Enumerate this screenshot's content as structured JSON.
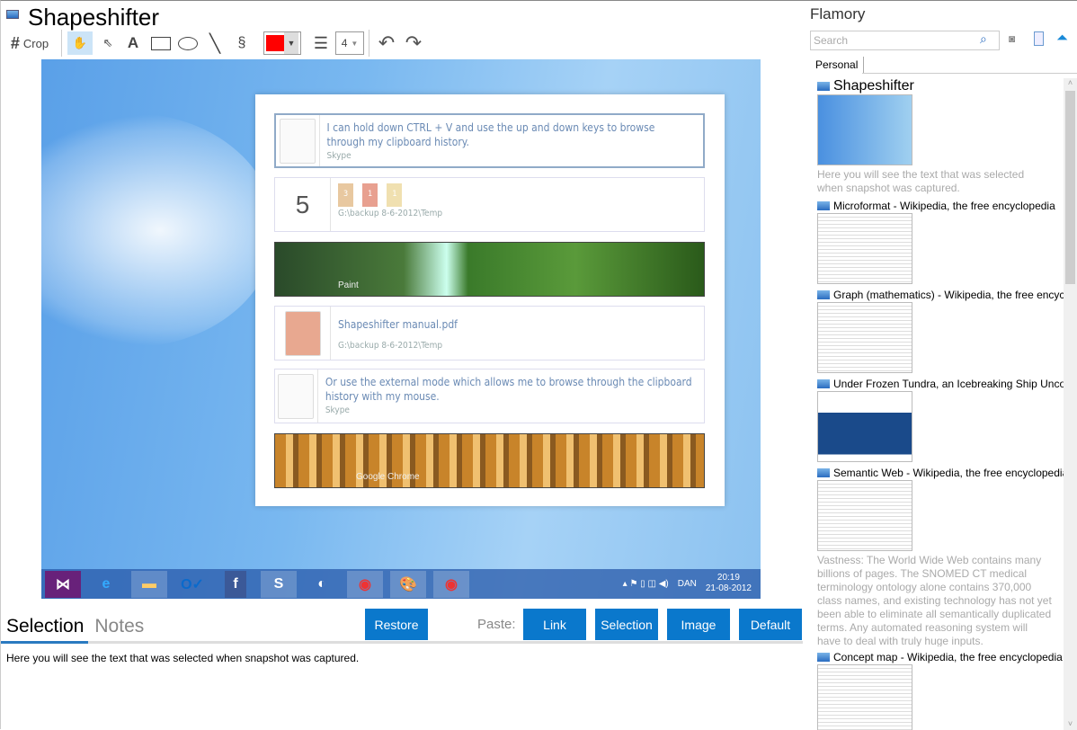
{
  "app": {
    "title": "Shapeshifter"
  },
  "toolbar": {
    "crop_label": "Crop",
    "tools": [
      "hand-icon",
      "pointer-icon",
      "text-icon",
      "rectangle-icon",
      "ellipse-icon",
      "line-icon",
      "freehand-icon"
    ],
    "text_tool_label": "A",
    "color": "#ff0000",
    "line_width": "4"
  },
  "canvas": {
    "items": [
      {
        "text": "I can hold down CTRL + V and use the up and down keys to browse through my clipboard history.",
        "source": "Skype"
      },
      {
        "count": "5",
        "badges": [
          "3",
          "1",
          "1"
        ],
        "source": "G:\\backup 8-6-2012\\Temp"
      },
      {
        "source": "Paint"
      },
      {
        "text": "Shapeshifter manual.pdf",
        "source": "G:\\backup 8-6-2012\\Temp"
      },
      {
        "text": "Or use the external mode which allows me to browse through the clipboard history with my mouse.",
        "source": "Skype"
      },
      {
        "source": "Google Chrome"
      }
    ],
    "taskbar": {
      "lang": "DAN",
      "time": "20:19",
      "date": "21-08-2012"
    }
  },
  "bottom": {
    "tabs": [
      "Selection",
      "Notes"
    ],
    "restore": "Restore",
    "paste_label": "Paste:",
    "paste_buttons": [
      "Link",
      "Selection",
      "Image",
      "Default"
    ],
    "selection_text": "Here you will see the text that was selected when snapshot was captured."
  },
  "flamory": {
    "title": "Flamory",
    "search_placeholder": "Search",
    "tab": "Personal",
    "entries": [
      {
        "title": "Shapeshifter",
        "desc": "Here you will see the text that was selected when snapshot was captured."
      },
      {
        "title": "Microformat - Wikipedia, the free encyclopedia"
      },
      {
        "title": "Graph (mathematics) - Wikipedia, the free encyclopedia"
      },
      {
        "title": "Under Frozen Tundra, an Icebreaking Ship Uncovers"
      },
      {
        "title": "Semantic Web - Wikipedia, the free encyclopedia",
        "desc": "Vastness: The World Wide Web contains many billions of pages. The SNOMED CT medical terminology ontology alone contains 370,000 class names, and existing technology has not yet been able to eliminate all semantically duplicated terms. Any automated reasoning system will have to deal with truly huge inputs."
      },
      {
        "title": "Concept map - Wikipedia, the free encyclopedia"
      }
    ]
  }
}
